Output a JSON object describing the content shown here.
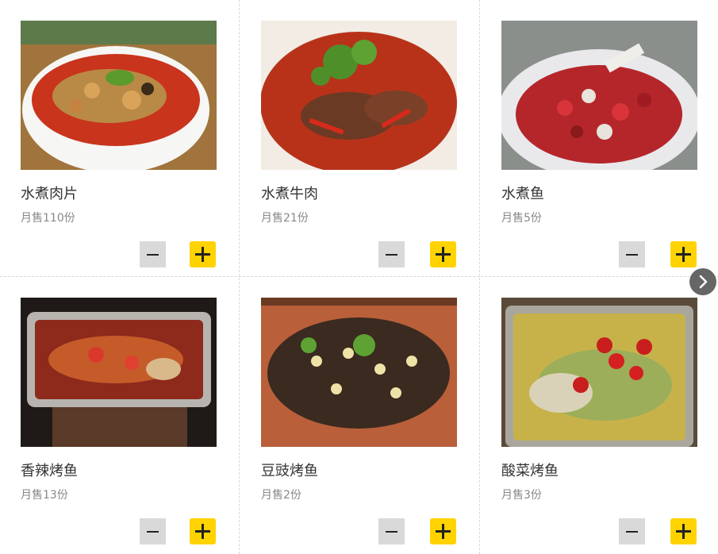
{
  "dishes": [
    {
      "name": "水煮肉片",
      "sold": "月售110份",
      "image": "boiled-pork-slices-bowl"
    },
    {
      "name": "水煮牛肉",
      "sold": "月售21份",
      "image": "boiled-beef-bowl"
    },
    {
      "name": "水煮鱼",
      "sold": "月售5份",
      "image": "boiled-fish-plate"
    },
    {
      "name": "香辣烤鱼",
      "sold": "月售13份",
      "image": "spicy-grilled-fish-tray"
    },
    {
      "name": "豆豉烤鱼",
      "sold": "月售2份",
      "image": "black-bean-grilled-fish-tray"
    },
    {
      "name": "酸菜烤鱼",
      "sold": "月售3份",
      "image": "pickled-cabbage-grilled-fish-tray"
    }
  ],
  "icons": {
    "minus": "minus-icon",
    "plus": "plus-icon",
    "next": "chevron-right-icon"
  },
  "colors": {
    "plus_button": "#ffd300",
    "minus_button": "#d9d9d9",
    "next_button": "#666666"
  }
}
